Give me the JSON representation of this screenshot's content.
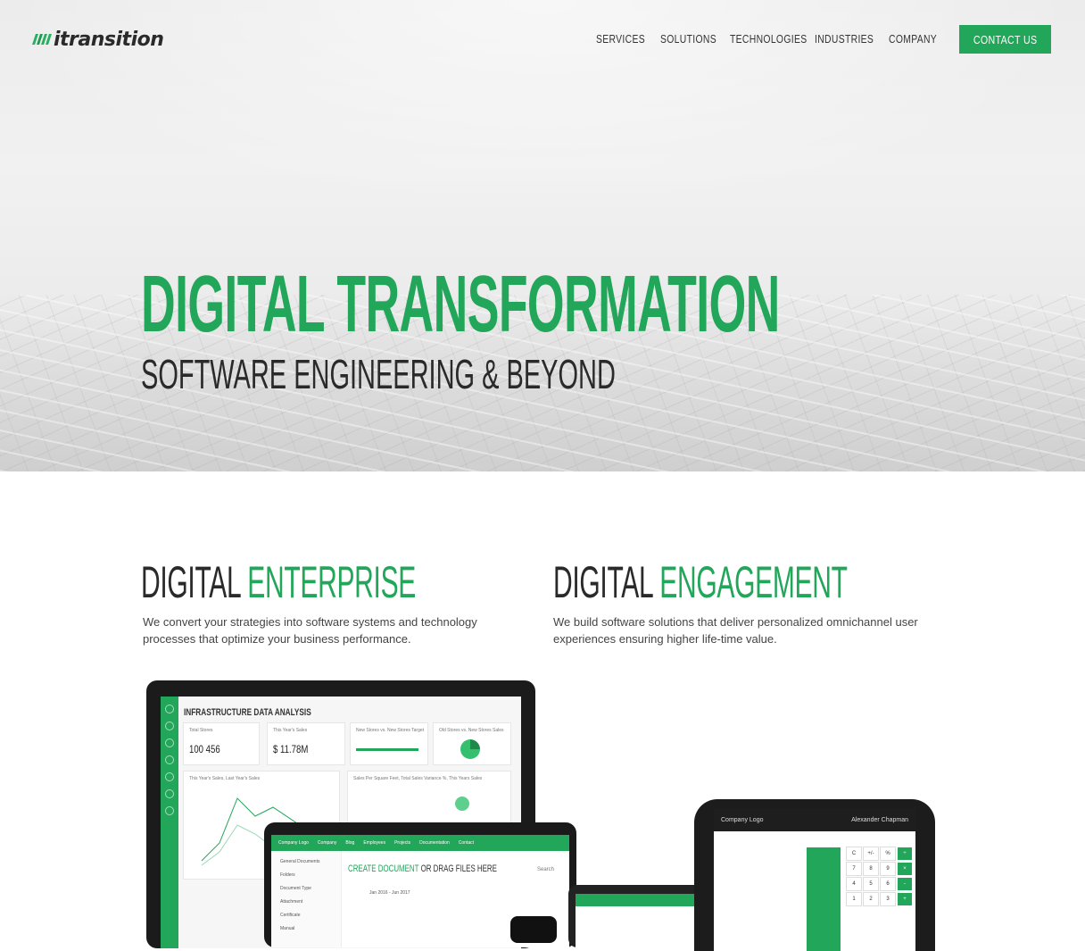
{
  "brand": {
    "name": "itransition",
    "accent_color": "#22a65a"
  },
  "nav": {
    "items": [
      "SERVICES",
      "SOLUTIONS",
      "TECHNOLOGIES",
      "INDUSTRIES",
      "COMPANY"
    ],
    "contact_label": "CONTACT US"
  },
  "hero": {
    "title": "DIGITAL TRANSFORMATION",
    "subtitle": "SOFTWARE ENGINEERING & BEYOND"
  },
  "sections": [
    {
      "title_dark": "DIGITAL",
      "title_green": "ENTERPRISE",
      "description": "We convert your strategies into software systems and technology processes that optimize your business performance."
    },
    {
      "title_dark": "DIGITAL",
      "title_green": "ENGAGEMENT",
      "description": "We build software solutions that deliver personalized omnichannel user experiences ensuring higher life-time value."
    }
  ],
  "devices": {
    "monitor": {
      "heading": "INFRASTRUCTURE DATA ANALYSIS",
      "cards": [
        {
          "label": "Total Stores",
          "value": "100 456"
        },
        {
          "label": "This Year's Sales",
          "value": "$ 11.78M"
        },
        {
          "label": "New Stores vs. New Stores Target",
          "value": ""
        },
        {
          "label": "Old Stores vs. New Stores Sales",
          "value": ""
        },
        {
          "label": "This Year's Sales, Last Year's Sales",
          "value": ""
        },
        {
          "label": "Sales Per Square Feet, Total Sales Variance %, This Years Sales",
          "value": ""
        }
      ]
    },
    "tablet": {
      "top_items": [
        "Company Logo",
        "Company",
        "Blog",
        "Employees",
        "Projects",
        "Documentation",
        "Contact"
      ],
      "side_items": [
        "General Documents",
        "Folders",
        "Document Type",
        "Attachment",
        "Certificate",
        "Manual"
      ],
      "title_green": "CREATE DOCUMENT",
      "title_dark": "OR DRAG FILES HERE",
      "period": "Jan 2016 - Jun 2017",
      "search": "Search"
    },
    "pos": {
      "logo": "Company Logo",
      "user": "Alexander Chapman",
      "keys": [
        "C",
        "+/-",
        "%",
        "÷",
        "7",
        "8",
        "9",
        "×",
        "4",
        "5",
        "6",
        "-",
        "1",
        "2",
        "3",
        "+"
      ]
    }
  }
}
